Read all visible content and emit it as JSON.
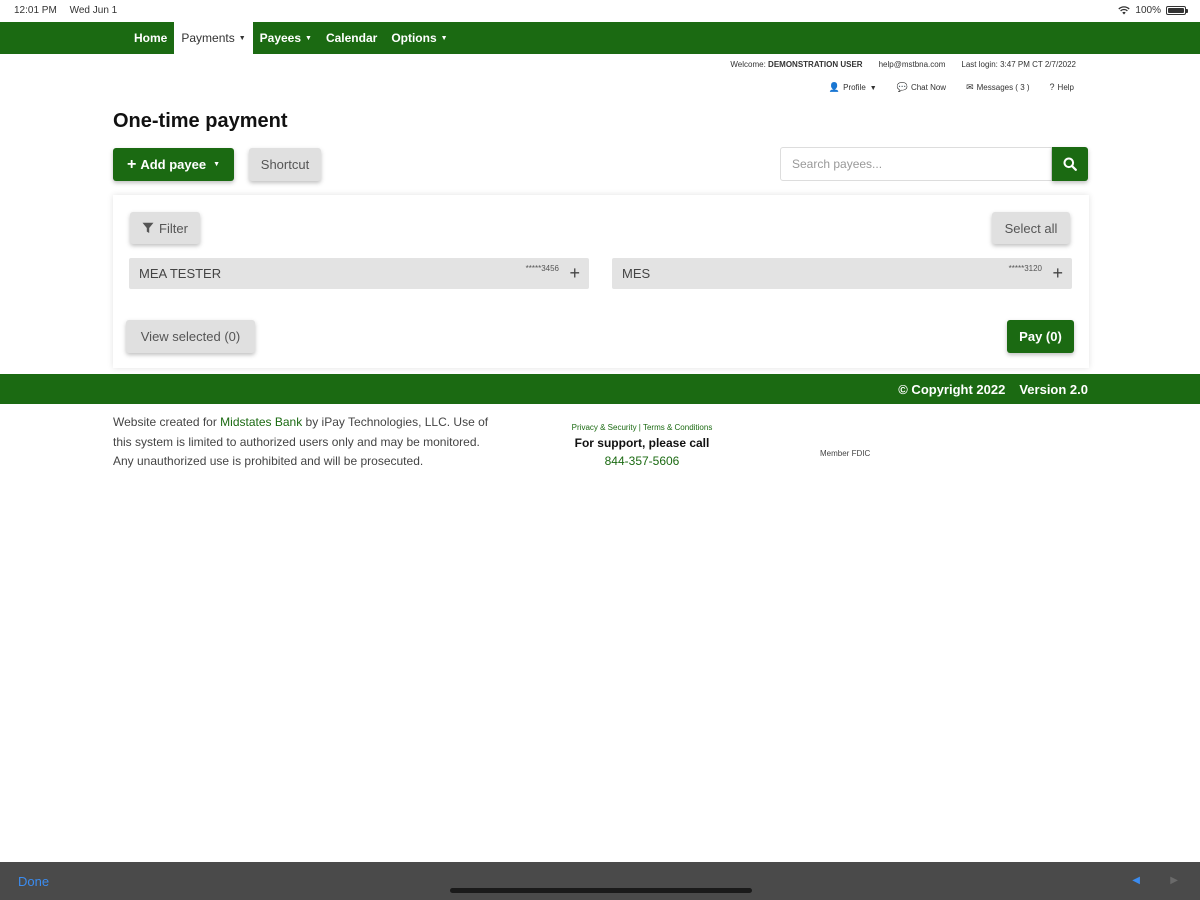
{
  "status_bar": {
    "time": "12:01 PM",
    "date": "Wed Jun 1",
    "battery": "100%"
  },
  "nav": {
    "items": [
      {
        "label": "Home",
        "active": false,
        "dropdown": false
      },
      {
        "label": "Payments",
        "active": true,
        "dropdown": true
      },
      {
        "label": "Payees",
        "active": false,
        "dropdown": true
      },
      {
        "label": "Calendar",
        "active": false,
        "dropdown": false
      },
      {
        "label": "Options",
        "active": false,
        "dropdown": true
      }
    ]
  },
  "header": {
    "welcome_label": "Welcome:",
    "user_name": "DEMONSTRATION USER",
    "email": "help@mstbna.com",
    "last_login": "Last login: 3:47 PM CT 2/7/2022",
    "links": {
      "profile": "Profile",
      "chat": "Chat Now",
      "messages": "Messages ( 3 )",
      "help": "Help"
    }
  },
  "page": {
    "title": "One-time payment",
    "add_payee_label": "Add payee",
    "shortcut_label": "Shortcut",
    "search_placeholder": "Search payees..."
  },
  "payees": {
    "filter_label": "Filter",
    "select_all_label": "Select all",
    "list": [
      {
        "name": "MEA TESTER",
        "account": "*****3456"
      },
      {
        "name": "MES",
        "account": "*****3120"
      }
    ],
    "view_selected_label": "View selected (0)",
    "pay_label": "Pay (0)"
  },
  "footer": {
    "copyright": "© Copyright  2022",
    "version": "Version 2.0",
    "notice_prefix": "Website created for ",
    "bank_name": "Midstates Bank",
    "notice_suffix": " by iPay Technologies, LLC. Use of this system is limited to authorized users only and may be monitored. Any unauthorized use is prohibited and will be prosecuted.",
    "privacy_link": "Privacy & Security",
    "terms_link": "Terms & Conditions",
    "support_text": "For support, please call",
    "phone": "844-357-5606",
    "fdic": "Member FDIC"
  },
  "bottom_bar": {
    "done_label": "Done"
  },
  "colors": {
    "brand_green": "#1b6a12",
    "link_blue": "#3b8cf0",
    "button_gray": "#e0e0e0"
  }
}
